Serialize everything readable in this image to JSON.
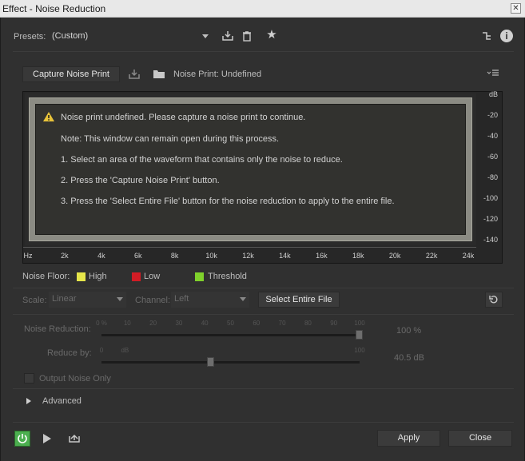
{
  "window": {
    "title": "Effect - Noise Reduction"
  },
  "presets": {
    "label": "Presets:",
    "value": "(Custom)"
  },
  "capture": {
    "button_label": "Capture Noise Print",
    "status": "Noise Print: Undefined"
  },
  "graph": {
    "message": {
      "line1": "Noise print undefined. Please capture a noise print to continue.",
      "line2": "Note: This window can remain open during this process.",
      "line3": "1. Select an area of the waveform that contains only the noise to reduce.",
      "line4": "2. Press the 'Capture Noise Print' button.",
      "line5": "3. Press the 'Select Entire File' button for the noise reduction to apply to the entire file."
    },
    "y_ticks": [
      "dB",
      "-20",
      "-40",
      "-60",
      "-80",
      "-100",
      "-120",
      "-140"
    ],
    "x_ticks": [
      "Hz",
      "2k",
      "4k",
      "6k",
      "8k",
      "10k",
      "12k",
      "14k",
      "16k",
      "18k",
      "20k",
      "22k",
      "24k"
    ]
  },
  "legend": {
    "label": "Noise Floor:",
    "items": [
      {
        "name": "High",
        "color": "#e6e64a"
      },
      {
        "name": "Low",
        "color": "#d11c25"
      },
      {
        "name": "Threshold",
        "color": "#7fd12b"
      }
    ]
  },
  "scale": {
    "label": "Scale:",
    "value": "Linear"
  },
  "channel": {
    "label": "Channel:",
    "value": "Left"
  },
  "select_entire_file": "Select Entire File",
  "noise_reduction": {
    "label": "Noise Reduction:",
    "value_text": "100 %",
    "value": 100,
    "ticks": [
      "0 %",
      "10",
      "20",
      "30",
      "40",
      "50",
      "60",
      "70",
      "80",
      "90",
      "100"
    ]
  },
  "reduce_by": {
    "label": "Reduce by:",
    "value_text": "40.5 dB",
    "value": 40.5,
    "min": 0,
    "max": 100,
    "ticks": [
      "0",
      "dB",
      "",
      "",
      "",
      "",
      "",
      "",
      "",
      "",
      "",
      "100"
    ]
  },
  "output_noise_only": "Output Noise Only",
  "advanced": "Advanced",
  "footer": {
    "apply": "Apply",
    "close": "Close"
  },
  "colors": {
    "power": "#4caf50",
    "background": "#303030"
  }
}
